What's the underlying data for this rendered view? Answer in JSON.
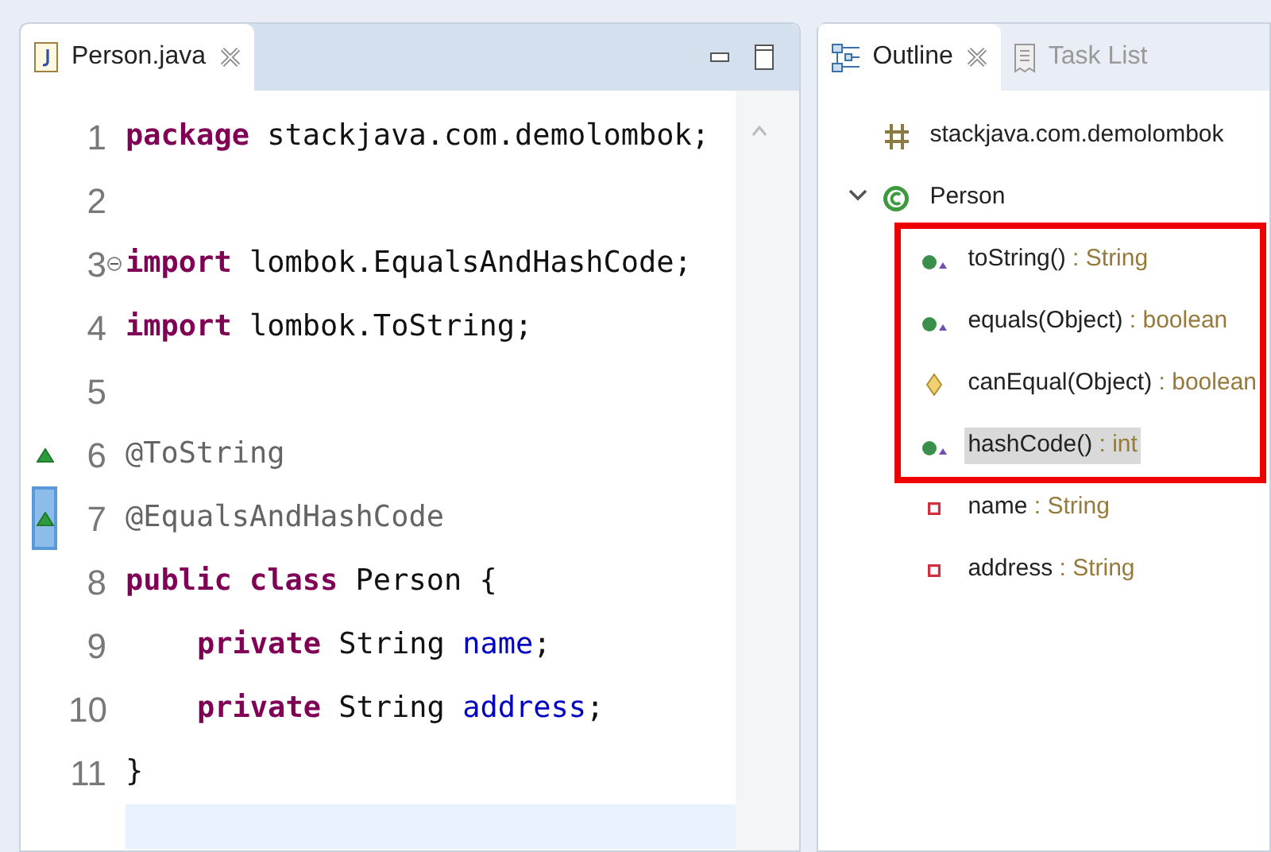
{
  "editor": {
    "tab": {
      "title": "Person.java",
      "selected": true
    },
    "lines": [
      {
        "number": "1",
        "tokens": [
          {
            "kind": "keyword",
            "text": "package"
          },
          {
            "kind": "plain",
            "text": " stackjava.com.demolombok;"
          }
        ]
      },
      {
        "number": "2"
      },
      {
        "number": "3",
        "fold": true,
        "tokens": [
          {
            "kind": "keyword",
            "text": "import"
          },
          {
            "kind": "plain",
            "text": " lombok.EqualsAndHashCode;"
          }
        ]
      },
      {
        "number": "4",
        "tokens": [
          {
            "kind": "keyword",
            "text": "import"
          },
          {
            "kind": "plain",
            "text": " lombok.ToString;"
          }
        ]
      },
      {
        "number": "5"
      },
      {
        "number": "6",
        "override": true,
        "tokens": [
          {
            "kind": "annotation",
            "text": "@ToString"
          }
        ]
      },
      {
        "number": "7",
        "override": true,
        "diff_selected": true,
        "tokens": [
          {
            "kind": "annotation",
            "text": "@EqualsAndHashCode"
          }
        ]
      },
      {
        "number": "8",
        "tokens": [
          {
            "kind": "keyword",
            "text": "public class"
          },
          {
            "kind": "plain",
            "text": " Person {"
          }
        ]
      },
      {
        "number": "9",
        "indent": true,
        "tokens": [
          {
            "kind": "keyword",
            "text": "private"
          },
          {
            "kind": "plain",
            "text": " String "
          },
          {
            "kind": "field",
            "text": "name"
          },
          {
            "kind": "plain",
            "text": ";"
          }
        ]
      },
      {
        "number": "10",
        "indent": true,
        "tokens": [
          {
            "kind": "keyword",
            "text": "private"
          },
          {
            "kind": "plain",
            "text": " String "
          },
          {
            "kind": "field",
            "text": "address"
          },
          {
            "kind": "plain",
            "text": ";"
          }
        ]
      },
      {
        "number": "11",
        "tokens": [
          {
            "kind": "plain",
            "text": "}"
          }
        ]
      }
    ]
  },
  "outline": {
    "tabs": [
      {
        "label": "Outline",
        "kind": "outline",
        "selected": true
      },
      {
        "label": "Task List",
        "kind": "tasks",
        "selected": false
      }
    ],
    "tree": [
      {
        "kind": "package",
        "label": "stackjava.com.demolombok"
      },
      {
        "kind": "class",
        "label": "Person",
        "expanded": true,
        "children": [
          {
            "kind": "public-method",
            "label": "toString()",
            "type": " : String",
            "selected": false,
            "highlighted": true
          },
          {
            "kind": "public-method",
            "label": "equals(Object)",
            "type": " : boolean",
            "selected": false,
            "highlighted": true
          },
          {
            "kind": "protected-method",
            "label": "canEqual(Object)",
            "type": " : boolean",
            "selected": false,
            "highlighted": true
          },
          {
            "kind": "public-method",
            "label": "hashCode()",
            "type": " : int",
            "selected": true,
            "highlighted": true
          },
          {
            "kind": "private-field",
            "label": "name",
            "type": " : String",
            "selected": false
          },
          {
            "kind": "private-field",
            "label": "address",
            "type": " : String",
            "selected": false
          }
        ]
      }
    ]
  }
}
